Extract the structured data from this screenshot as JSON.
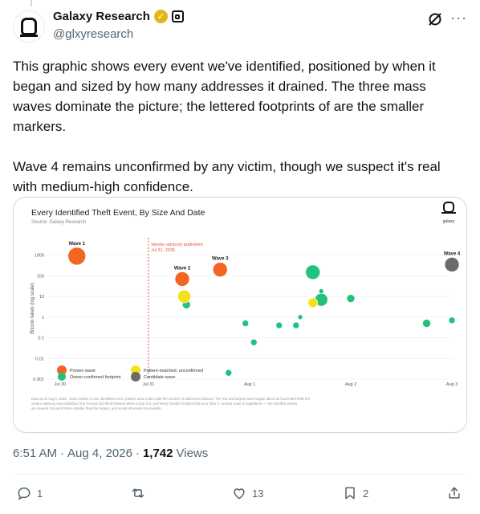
{
  "author": {
    "display_name": "Galaxy Research",
    "handle": "@glxyresearch",
    "verified_icon": "gold-check-icon",
    "affiliate_icon": "square-badge-icon"
  },
  "tweet": {
    "paragraphs": [
      "This graphic shows every event we've identified, positioned by when it began and sized by how many addresses it drained. The three mass waves dominate the picture; the lettered footprints of are the smaller markers.",
      "Wave 4 remains unconfirmed by any victim, though we suspect it's real with medium-high confidence."
    ]
  },
  "chart_image": {
    "title": "Every Identified Theft Event, By Size And Date",
    "source": "Source: Galaxy Research",
    "logo_label": "galaxy",
    "ylabel": "Bitcoin taken (log scale)",
    "vline_label_1": "Vendor advisory published",
    "vline_label_2": "Jul 31, 2026",
    "footnote_1": "Data as of Aug 3, 2026 · Each marker is one identified event; marker area scales with the number of addresses drained. The first and largest wave began about 30 hours BEFORE the",
    "footnote_2": "vendor advisory was published; the second and third followed within a day of it, and every smaller footprint falls at or after it. Vertical scale is logarithmic — the smallest events",
    "footnote_3": "are several thousand times smaller than the largest, and would otherwise be invisible.",
    "legend": {
      "proven": "Proven wave",
      "owner": "Owner-confirmed footprint",
      "pattern": "Pattern-matched, unconfirmed",
      "candidate": "Candidate wave"
    },
    "colors": {
      "proven": "#f26522",
      "owner": "#22c27a",
      "pattern": "#f5e11a",
      "candidate": "#6b6b6b",
      "vline": "#e8503a"
    }
  },
  "chart_data": {
    "type": "scatter",
    "title": "Every Identified Theft Event, By Size And Date",
    "ylabel": "Bitcoin taken (log scale)",
    "y_scale": "log",
    "ylim": [
      0.001,
      2000
    ],
    "y_ticks": [
      "1000",
      "100",
      "10",
      "1",
      "0.1",
      "0.01",
      "0.001"
    ],
    "x_ticks": [
      "Jul 30",
      "Jul 31",
      "Aug 1",
      "Aug 2",
      "Aug 3"
    ],
    "xlim": [
      "2026-07-30T00:00",
      "2026-08-03T00:00"
    ],
    "vline": {
      "x": "2026-07-31T00:00",
      "label": "Vendor advisory published Jul 31, 2026"
    },
    "legend_position": "bottom-left",
    "series": [
      {
        "name": "Proven wave",
        "points": [
          {
            "x": "2026-07-30T07:00",
            "y": 900,
            "label": "Wave 1",
            "r": 11
          },
          {
            "x": "2026-07-31T08:00",
            "y": 70,
            "label": "Wave 2",
            "r": 9
          },
          {
            "x": "2026-07-31T17:00",
            "y": 200,
            "label": "Wave 3",
            "r": 9
          }
        ]
      },
      {
        "name": "Owner-confirmed footprint",
        "points": [
          {
            "x": "2026-07-31T09:00",
            "y": 4,
            "r": 5
          },
          {
            "x": "2026-07-31T23:00",
            "y": 0.5,
            "r": 4
          },
          {
            "x": "2026-08-01T01:00",
            "y": 0.06,
            "r": 4
          },
          {
            "x": "2026-08-01T07:00",
            "y": 0.4,
            "r": 4
          },
          {
            "x": "2026-08-01T11:00",
            "y": 0.4,
            "r": 4
          },
          {
            "x": "2026-08-01T12:00",
            "y": 1,
            "r": 3
          },
          {
            "x": "2026-08-01T15:00",
            "y": 150,
            "r": 9
          },
          {
            "x": "2026-08-01T17:00",
            "y": 7,
            "r": 8
          },
          {
            "x": "2026-08-01T17:00",
            "y": 18,
            "r": 3
          },
          {
            "x": "2026-08-02T00:00",
            "y": 8,
            "r": 5
          },
          {
            "x": "2026-07-31T19:00",
            "y": 0.002,
            "r": 4
          },
          {
            "x": "2026-08-02T18:00",
            "y": 0.5,
            "r": 5
          },
          {
            "x": "2026-08-03T00:00",
            "y": 0.7,
            "r": 4
          }
        ]
      },
      {
        "name": "Pattern-matched, unconfirmed",
        "points": [
          {
            "x": "2026-07-31T08:30",
            "y": 10,
            "r": 8
          },
          {
            "x": "2026-08-01T15:00",
            "y": 5,
            "r": 6
          }
        ]
      },
      {
        "name": "Candidate wave",
        "points": [
          {
            "x": "2026-08-03T00:00",
            "y": 350,
            "label": "Wave 4",
            "r": 9
          }
        ]
      }
    ]
  },
  "meta": {
    "time": "6:51 AM",
    "separator": "·",
    "date": "Aug 4, 2026",
    "views_count": "1,742",
    "views_label": "Views"
  },
  "actions": {
    "replies": "1",
    "reposts": "",
    "likes": "13",
    "bookmarks": "2"
  }
}
